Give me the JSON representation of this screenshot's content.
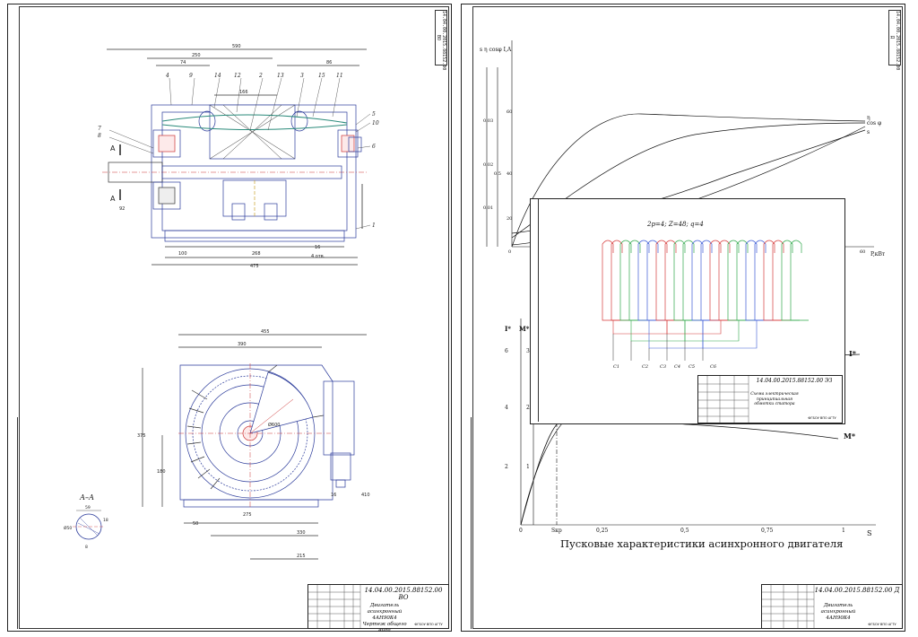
{
  "left_sheet": {
    "corner_code": "14.04.00.2015.88152.00 ВО",
    "title_block": {
      "code": "14.04.00.2015.88152.00 ВО",
      "title": "Двигатель асинхронный 4АН90К4",
      "subtitle": "Чертеж общего вида",
      "org": "ФГБОУ ВПО АГТУ"
    },
    "section_label": "А–А",
    "dimensions": {
      "overall_length": "590",
      "d250": "250",
      "d74": "74",
      "d166": "166",
      "d86": "86",
      "d100": "100",
      "d268": "268",
      "d475": "475",
      "d92": "92",
      "d16": "16",
      "holes": "4 отв.",
      "bottom_width": "455",
      "d390": "390",
      "height": "375",
      "d180": "180",
      "d275": "275",
      "d330": "330",
      "d215": "215",
      "d50": "50",
      "d410": "410",
      "d16b": "16",
      "d59": "59",
      "d18": "18",
      "d8": "8",
      "phi50": "Ø50",
      "phi600": "Ø600"
    },
    "leaders": [
      "7",
      "8",
      "4",
      "9",
      "14",
      "12",
      "2",
      "13",
      "3",
      "15",
      "11",
      "5",
      "10",
      "6",
      "1"
    ],
    "cut_marker": "А"
  },
  "right_sheet": {
    "corner_code": "14.04.00.2015.88152.00 Д",
    "caption": "Пусковые характеристики асинхронного двигателя",
    "title_block": {
      "code": "14.04.00.2015.88152.00 Д",
      "title": "Двигатель асинхронный 4АН90К4",
      "org": "ФГБОУ ВПО АГТУ"
    },
    "upper_chart": {
      "y_axis_label": "s η cosφ I,A",
      "x_axis_label": "P,кВт",
      "curve_labels": [
        "η",
        "cos φ",
        "s"
      ],
      "ticks": [
        "0.03",
        "0.02",
        "0.01",
        "60",
        "40",
        "20",
        "0.5",
        "0"
      ],
      "x_end_tick": "60"
    },
    "lower_chart": {
      "y_axis_label_i": "I*",
      "y_axis_label_m": "M*",
      "x_axis_label": "S",
      "x_ticks": [
        "0",
        "Sкр",
        "0,25",
        "0,5",
        "0,75",
        "1"
      ],
      "y_ticks_i": [
        "6",
        "4",
        "2"
      ],
      "y_ticks_m": [
        "3",
        "2",
        "1"
      ],
      "curve_label_i": "I*",
      "curve_label_m": "M*"
    },
    "insert_sheet": {
      "formula": "2p=4; Z=48; q=4",
      "phase_labels": [
        "C1",
        "C2",
        "C3",
        "C4",
        "C5",
        "C6"
      ],
      "title_block": {
        "code": "14.04.00.2015.88152.00 ЭЗ",
        "title": "Схема электрическая принципиальная обмотки статора",
        "org": "ФГБОУ ВПО АГТУ"
      }
    }
  },
  "colors": {
    "line": "#1a1a1a",
    "drawing_blue": "#2a3a9a",
    "winding_red": "#d63a3a",
    "winding_green": "#2fa84a",
    "winding_blue": "#3a5ad6",
    "highlight_teal": "#2a8a7a"
  }
}
